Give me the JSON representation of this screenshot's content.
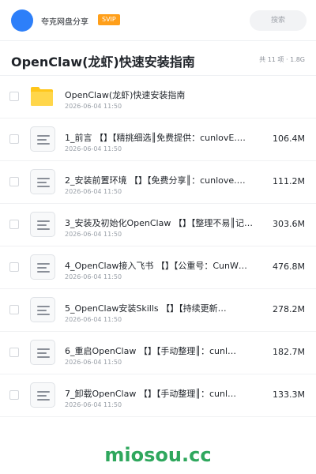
{
  "header": {
    "app_name": "夸克网盘分享",
    "badge": "SVIP",
    "search_placeholder": "搜索"
  },
  "folder": {
    "title": "OpenClaw(龙虾)快速安装指南",
    "meta": "共 11 项 · 1.8G"
  },
  "items": [
    {
      "name": "OpenClaw(龙虾)快速安装指南",
      "date": "2026-06-04 11:50",
      "size": "",
      "icon": "folder-icon"
    },
    {
      "name": "1_前言 【】【精挑细选║免费提供：cunlovE.…",
      "date": "2026-06-04 11:50",
      "size": "106.4M",
      "icon": "document-icon"
    },
    {
      "name": "2_安装前置环境 【】【免费分享║：cunlove.…",
      "date": "2026-06-04 11:50",
      "size": "111.2M",
      "icon": "document-icon"
    },
    {
      "name": "3_安装及初始化OpenClaw 【】【整理不易║记…",
      "date": "2026-06-04 11:50",
      "size": "303.6M",
      "icon": "document-icon"
    },
    {
      "name": "4_OpenClaw接入飞书 【】【公重号：CunW…",
      "date": "2026-06-04 11:50",
      "size": "476.8M",
      "icon": "document-icon"
    },
    {
      "name": "5_OpenClaw安装Skills 【】【持续更新…",
      "date": "2026-06-04 11:50",
      "size": "278.2M",
      "icon": "document-icon"
    },
    {
      "name": "6_重启OpenClaw 【】【手动整理║：cunl…",
      "date": "2026-06-04 11:50",
      "size": "182.7M",
      "icon": "document-icon"
    },
    {
      "name": "7_卸载OpenClaw 【】【手动整理║：cunl…",
      "date": "2026-06-04 11:50",
      "size": "133.3M",
      "icon": "document-icon"
    }
  ],
  "watermark": "miosou.cc",
  "colors": {
    "brand_blue": "#2d7ff9",
    "svip_orange": "#ff9f1a",
    "folder_yellow": "#ffc61a",
    "watermark_green": "#2fa75d"
  }
}
